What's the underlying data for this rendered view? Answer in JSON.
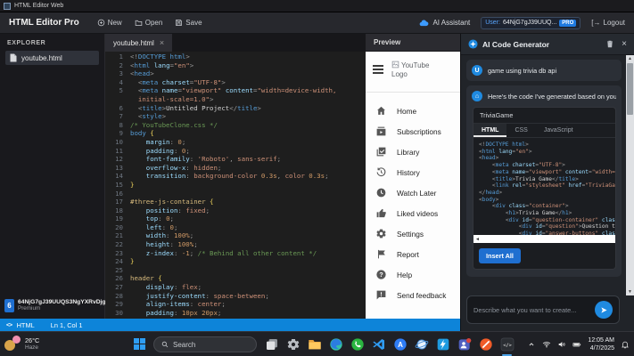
{
  "window": {
    "title": "HTML Editor Web"
  },
  "toolbar": {
    "app_name": "HTML Editor Pro",
    "new_label": "New",
    "open_label": "Open",
    "save_label": "Save",
    "ai_assistant_label": "AI Assistant",
    "user_label": "User:",
    "user_id": "64NjG7gJ39UUQ...",
    "pro_badge": "PRO",
    "logout_icon": "[→",
    "logout_label": "Logout"
  },
  "explorer": {
    "title": "EXPLORER",
    "file": "youtube.html"
  },
  "account": {
    "badge": "6",
    "id": "64NjG7gJ39UUQS3NgYXRvDjg",
    "plan": "Premium"
  },
  "editor": {
    "tab": "youtube.html",
    "close": "×",
    "lines": [
      {
        "n": "1",
        "t": [
          [
            "p",
            "<!"
          ],
          [
            "t",
            "DOCTYPE html"
          ],
          [
            "p",
            ">"
          ]
        ]
      },
      {
        "n": "2",
        "t": [
          [
            "p",
            "<"
          ],
          [
            "t",
            "html"
          ],
          [
            "d",
            " "
          ],
          [
            "a",
            "lang"
          ],
          [
            "p",
            "="
          ],
          [
            "s",
            "\"en\""
          ],
          [
            "p",
            ">"
          ]
        ]
      },
      {
        "n": "3",
        "t": [
          [
            "p",
            "<"
          ],
          [
            "t",
            "head"
          ],
          [
            "p",
            ">"
          ]
        ]
      },
      {
        "n": "4",
        "t": [
          [
            "d",
            "  "
          ],
          [
            "p",
            "<"
          ],
          [
            "t",
            "meta"
          ],
          [
            "d",
            " "
          ],
          [
            "a",
            "charset"
          ],
          [
            "p",
            "="
          ],
          [
            "s",
            "\"UTF-8\""
          ],
          [
            "p",
            ">"
          ]
        ]
      },
      {
        "n": "5",
        "t": [
          [
            "d",
            "  "
          ],
          [
            "p",
            "<"
          ],
          [
            "t",
            "meta"
          ],
          [
            "d",
            " "
          ],
          [
            "a",
            "name"
          ],
          [
            "p",
            "="
          ],
          [
            "s",
            "\"viewport\""
          ],
          [
            "d",
            " "
          ],
          [
            "a",
            "content"
          ],
          [
            "p",
            "="
          ],
          [
            "s",
            "\"width=device-width,"
          ]
        ]
      },
      {
        "n": "",
        "t": [
          [
            "s",
            "  initial-scale=1.0\""
          ],
          [
            "p",
            ">"
          ]
        ]
      },
      {
        "n": "6",
        "t": [
          [
            "d",
            "  "
          ],
          [
            "p",
            "<"
          ],
          [
            "t",
            "title"
          ],
          [
            "p",
            ">"
          ],
          [
            "d",
            "Untitled Project"
          ],
          [
            "p",
            "</"
          ],
          [
            "t",
            "title"
          ],
          [
            "p",
            ">"
          ]
        ]
      },
      {
        "n": "7",
        "t": [
          [
            "d",
            "  "
          ],
          [
            "p",
            "<"
          ],
          [
            "t",
            "style"
          ],
          [
            "p",
            ">"
          ]
        ]
      },
      {
        "n": "8",
        "t": [
          [
            "c",
            "/* YouTubeClone.css */"
          ]
        ]
      },
      {
        "n": "9",
        "t": [
          [
            "t",
            "body"
          ],
          [
            "b",
            " {"
          ]
        ]
      },
      {
        "n": "10",
        "t": [
          [
            "k",
            "    margin"
          ],
          [
            "p",
            ": "
          ],
          [
            "n",
            "0"
          ],
          [
            "p",
            ";"
          ]
        ]
      },
      {
        "n": "11",
        "t": [
          [
            "k",
            "    padding"
          ],
          [
            "p",
            ": "
          ],
          [
            "n",
            "0"
          ],
          [
            "p",
            ";"
          ]
        ]
      },
      {
        "n": "12",
        "t": [
          [
            "k",
            "    font-family"
          ],
          [
            "p",
            ": "
          ],
          [
            "s",
            "'Roboto'"
          ],
          [
            "p",
            ", "
          ],
          [
            "v",
            "sans-serif"
          ],
          [
            "p",
            ";"
          ]
        ]
      },
      {
        "n": "13",
        "t": [
          [
            "k",
            "    overflow-x"
          ],
          [
            "p",
            ": "
          ],
          [
            "v",
            "hidden"
          ],
          [
            "p",
            ";"
          ]
        ]
      },
      {
        "n": "14",
        "t": [
          [
            "k",
            "    transition"
          ],
          [
            "p",
            ": "
          ],
          [
            "v",
            "background-color "
          ],
          [
            "n",
            "0.3s"
          ],
          [
            "p",
            ", "
          ],
          [
            "v",
            "color "
          ],
          [
            "n",
            "0.3s"
          ],
          [
            "p",
            ";"
          ]
        ]
      },
      {
        "n": "15",
        "t": [
          [
            "b",
            "}"
          ]
        ]
      },
      {
        "n": "16",
        "t": []
      },
      {
        "n": "17",
        "t": [
          [
            "sel",
            "#three-js-container"
          ],
          [
            "b",
            " {"
          ]
        ]
      },
      {
        "n": "18",
        "t": [
          [
            "k",
            "    position"
          ],
          [
            "p",
            ": "
          ],
          [
            "v",
            "fixed"
          ],
          [
            "p",
            ";"
          ]
        ]
      },
      {
        "n": "19",
        "t": [
          [
            "k",
            "    top"
          ],
          [
            "p",
            ": "
          ],
          [
            "n",
            "0"
          ],
          [
            "p",
            ";"
          ]
        ]
      },
      {
        "n": "20",
        "t": [
          [
            "k",
            "    left"
          ],
          [
            "p",
            ": "
          ],
          [
            "n",
            "0"
          ],
          [
            "p",
            ";"
          ]
        ]
      },
      {
        "n": "21",
        "t": [
          [
            "k",
            "    width"
          ],
          [
            "p",
            ": "
          ],
          [
            "n",
            "100%"
          ],
          [
            "p",
            ";"
          ]
        ]
      },
      {
        "n": "22",
        "t": [
          [
            "k",
            "    height"
          ],
          [
            "p",
            ": "
          ],
          [
            "n",
            "100%"
          ],
          [
            "p",
            ";"
          ]
        ]
      },
      {
        "n": "23",
        "t": [
          [
            "k",
            "    z-index"
          ],
          [
            "p",
            ": "
          ],
          [
            "n",
            "-1"
          ],
          [
            "p",
            "; "
          ],
          [
            "c",
            "/* Behind all other content */"
          ]
        ]
      },
      {
        "n": "24",
        "t": [
          [
            "b",
            "}"
          ]
        ]
      },
      {
        "n": "25",
        "t": []
      },
      {
        "n": "26",
        "t": [
          [
            "sel",
            "header"
          ],
          [
            "b",
            " {"
          ]
        ]
      },
      {
        "n": "27",
        "t": [
          [
            "k",
            "    display"
          ],
          [
            "p",
            ": "
          ],
          [
            "v",
            "flex"
          ],
          [
            "p",
            ";"
          ]
        ]
      },
      {
        "n": "28",
        "t": [
          [
            "k",
            "    justify-content"
          ],
          [
            "p",
            ": "
          ],
          [
            "v",
            "space-between"
          ],
          [
            "p",
            ";"
          ]
        ]
      },
      {
        "n": "29",
        "t": [
          [
            "k",
            "    align-items"
          ],
          [
            "p",
            ": "
          ],
          [
            "v",
            "center"
          ],
          [
            "p",
            ";"
          ]
        ]
      },
      {
        "n": "30",
        "t": [
          [
            "k",
            "    padding"
          ],
          [
            "p",
            ": "
          ],
          [
            "n",
            "10px 20px"
          ],
          [
            "p",
            ";"
          ]
        ]
      }
    ]
  },
  "preview": {
    "title": "Preview",
    "logo_alt": "YouTube Logo",
    "menu": [
      {
        "icon": "home",
        "label": "Home"
      },
      {
        "icon": "subscriptions",
        "label": "Subscriptions"
      },
      {
        "icon": "library",
        "label": "Library"
      },
      {
        "icon": "history",
        "label": "History"
      },
      {
        "icon": "watch-later",
        "label": "Watch Later"
      },
      {
        "icon": "liked-videos",
        "label": "Liked videos"
      },
      {
        "icon": "settings",
        "label": "Settings"
      },
      {
        "icon": "report",
        "label": "Report"
      },
      {
        "icon": "help",
        "label": "Help"
      },
      {
        "icon": "send-feedback",
        "label": "Send feedback"
      }
    ]
  },
  "ai": {
    "title": "AI Code Generator",
    "close_icon": "×",
    "user_avatar": "U",
    "user_message": "game using trivia db api",
    "assistant_avatar": "⌂",
    "assistant_message": "Here's the code I've generated based on your re",
    "code": {
      "title": "TriviaGame",
      "tabs": [
        "HTML",
        "CSS",
        "JavaScript"
      ],
      "active": "HTML",
      "insert_label": "Insert All",
      "lines": [
        [
          [
            "p",
            "<!"
          ],
          [
            "t",
            "DOCTYPE html"
          ],
          [
            "p",
            ">"
          ]
        ],
        [
          [
            "p",
            "<"
          ],
          [
            "t",
            "html"
          ],
          [
            "d",
            " "
          ],
          [
            "a",
            "lang"
          ],
          [
            "p",
            "="
          ],
          [
            "s",
            "\"en\""
          ],
          [
            "p",
            ">"
          ]
        ],
        [
          [
            "p",
            "<"
          ],
          [
            "t",
            "head"
          ],
          [
            "p",
            ">"
          ]
        ],
        [
          [
            "d",
            "    "
          ],
          [
            "p",
            "<"
          ],
          [
            "t",
            "meta"
          ],
          [
            "d",
            " "
          ],
          [
            "a",
            "charset"
          ],
          [
            "p",
            "="
          ],
          [
            "s",
            "\"UTF-8\""
          ],
          [
            "p",
            ">"
          ]
        ],
        [
          [
            "d",
            "    "
          ],
          [
            "p",
            "<"
          ],
          [
            "t",
            "meta"
          ],
          [
            "d",
            " "
          ],
          [
            "a",
            "name"
          ],
          [
            "p",
            "="
          ],
          [
            "s",
            "\"viewport\""
          ],
          [
            "d",
            " "
          ],
          [
            "a",
            "content"
          ],
          [
            "p",
            "="
          ],
          [
            "s",
            "\"width=de"
          ]
        ],
        [
          [
            "d",
            "    "
          ],
          [
            "p",
            "<"
          ],
          [
            "t",
            "title"
          ],
          [
            "p",
            ">"
          ],
          [
            "d",
            "Trivia Game"
          ],
          [
            "p",
            "</"
          ],
          [
            "t",
            "title"
          ],
          [
            "p",
            ">"
          ]
        ],
        [
          [
            "d",
            "    "
          ],
          [
            "p",
            "<"
          ],
          [
            "t",
            "link"
          ],
          [
            "d",
            " "
          ],
          [
            "a",
            "rel"
          ],
          [
            "p",
            "="
          ],
          [
            "s",
            "\"stylesheet\""
          ],
          [
            "d",
            " "
          ],
          [
            "a",
            "href"
          ],
          [
            "p",
            "="
          ],
          [
            "s",
            "\"TriviaGame."
          ]
        ],
        [
          [
            "p",
            "</"
          ],
          [
            "t",
            "head"
          ],
          [
            "p",
            ">"
          ]
        ],
        [
          [
            "p",
            "<"
          ],
          [
            "t",
            "body"
          ],
          [
            "p",
            ">"
          ]
        ],
        [
          [
            "d",
            "    "
          ],
          [
            "p",
            "<"
          ],
          [
            "t",
            "div"
          ],
          [
            "d",
            " "
          ],
          [
            "a",
            "class"
          ],
          [
            "p",
            "="
          ],
          [
            "s",
            "\"container\""
          ],
          [
            "p",
            ">"
          ]
        ],
        [
          [
            "d",
            "        "
          ],
          [
            "p",
            "<"
          ],
          [
            "t",
            "h1"
          ],
          [
            "p",
            ">"
          ],
          [
            "d",
            "Trivia Game"
          ],
          [
            "p",
            "</"
          ],
          [
            "t",
            "h1"
          ],
          [
            "p",
            ">"
          ]
        ],
        [
          [
            "d",
            "        "
          ],
          [
            "p",
            "<"
          ],
          [
            "t",
            "div"
          ],
          [
            "d",
            " "
          ],
          [
            "a",
            "id"
          ],
          [
            "p",
            "="
          ],
          [
            "s",
            "\"question-container\""
          ],
          [
            "d",
            " "
          ],
          [
            "a",
            "class"
          ],
          [
            "p",
            "="
          ],
          [
            "s",
            "\""
          ]
        ],
        [
          [
            "d",
            "            "
          ],
          [
            "p",
            "<"
          ],
          [
            "t",
            "div"
          ],
          [
            "d",
            " "
          ],
          [
            "a",
            "id"
          ],
          [
            "p",
            "="
          ],
          [
            "s",
            "\"question\""
          ],
          [
            "p",
            ">"
          ],
          [
            "d",
            "Question tex"
          ]
        ],
        [
          [
            "d",
            "            "
          ],
          [
            "p",
            "<"
          ],
          [
            "t",
            "div"
          ],
          [
            "d",
            " "
          ],
          [
            "a",
            "id"
          ],
          [
            "p",
            "="
          ],
          [
            "s",
            "\"answer-buttons\""
          ],
          [
            "d",
            " "
          ],
          [
            "a",
            "class"
          ],
          [
            "p",
            "="
          ],
          [
            "s",
            "\""
          ]
        ]
      ]
    },
    "input_placeholder": "Describe what you want to create..."
  },
  "statusbar": {
    "icon": "<>",
    "lang": "HTML",
    "cursor": "Ln 1, Col 1"
  },
  "taskbar": {
    "weather_temp": "26°C",
    "weather_cond": "Haze",
    "search_placeholder": "Search",
    "icons": [
      "task-view",
      "gear",
      "file-explorer",
      "edge",
      "whatsapp",
      "vscode",
      "app-a",
      "browser",
      "bolt",
      "teams",
      "brave",
      "html-editor"
    ],
    "time": "12:05 AM",
    "date": "4/7/2025"
  }
}
